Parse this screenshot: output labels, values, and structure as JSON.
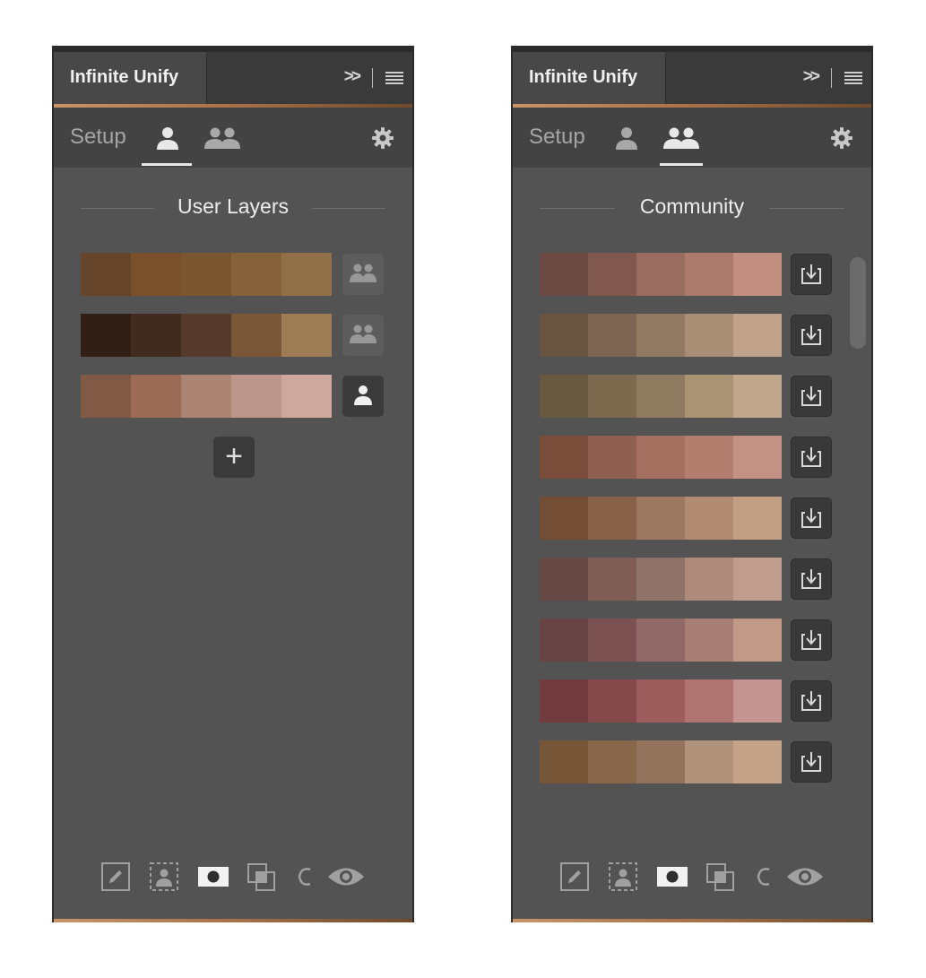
{
  "colors": {
    "panel_bg": "#535353",
    "accent": "#a87148",
    "panels_left_rows": [
      [
        "#66452a",
        "#7a4f2c",
        "#7c5631",
        "#87613a",
        "#916f48"
      ],
      [
        "#311f15",
        "#412b1e",
        "#563b2c",
        "#7a5737",
        "#9d7c56"
      ],
      [
        "#825945",
        "#9b6b56",
        "#ac8473",
        "#bc968a",
        "#cea79d"
      ]
    ],
    "panels_right_rows": [
      [
        "#6c4a43",
        "#81584e",
        "#996c60",
        "#ad7b6b",
        "#c28e80"
      ],
      [
        "#695341",
        "#7e6553",
        "#927a62",
        "#a98d75",
        "#c1a28a"
      ],
      [
        "#685a40",
        "#7b6a4e",
        "#8f7b60",
        "#a99373",
        "#c0a68a"
      ],
      [
        "#7a4c3a",
        "#8f5f51",
        "#a67061",
        "#b47e6f",
        "#c49284"
      ],
      [
        "#744e34",
        "#866148",
        "#9b785f",
        "#b08b72",
        "#c29e83"
      ],
      [
        "#664845",
        "#7f5d55",
        "#8f7369",
        "#ae8a7c",
        "#c09c8f"
      ],
      [
        "#684444",
        "#7b5151",
        "#916a67",
        "#a87d74",
        "#c29886"
      ],
      [
        "#723b3e",
        "#86494b",
        "#9c5e5c",
        "#b07572",
        "#c39490"
      ],
      [
        "#775637",
        "#876649",
        "#93735c",
        "#b09179",
        "#c4a389"
      ]
    ]
  },
  "panels": [
    {
      "title": "Infinite Unify",
      "collapse_label": ">>",
      "setup_label": "Setup",
      "active_tab": "user",
      "section_title": "User Layers",
      "row_buttons": [
        "group-icon",
        "group-icon",
        "user-icon"
      ],
      "add_label": "+",
      "icons": [
        "pencil-icon",
        "portrait-select-icon",
        "mask-icon",
        "overlap-icon",
        "c-icon",
        "eye-icon"
      ]
    },
    {
      "title": "Infinite Unify",
      "collapse_label": ">>",
      "setup_label": "Setup",
      "active_tab": "community",
      "section_title": "Community",
      "row_button_icon": "download-icon",
      "icons": [
        "pencil-icon",
        "portrait-select-icon",
        "mask-icon",
        "overlap-icon",
        "c-icon",
        "eye-icon"
      ]
    }
  ]
}
